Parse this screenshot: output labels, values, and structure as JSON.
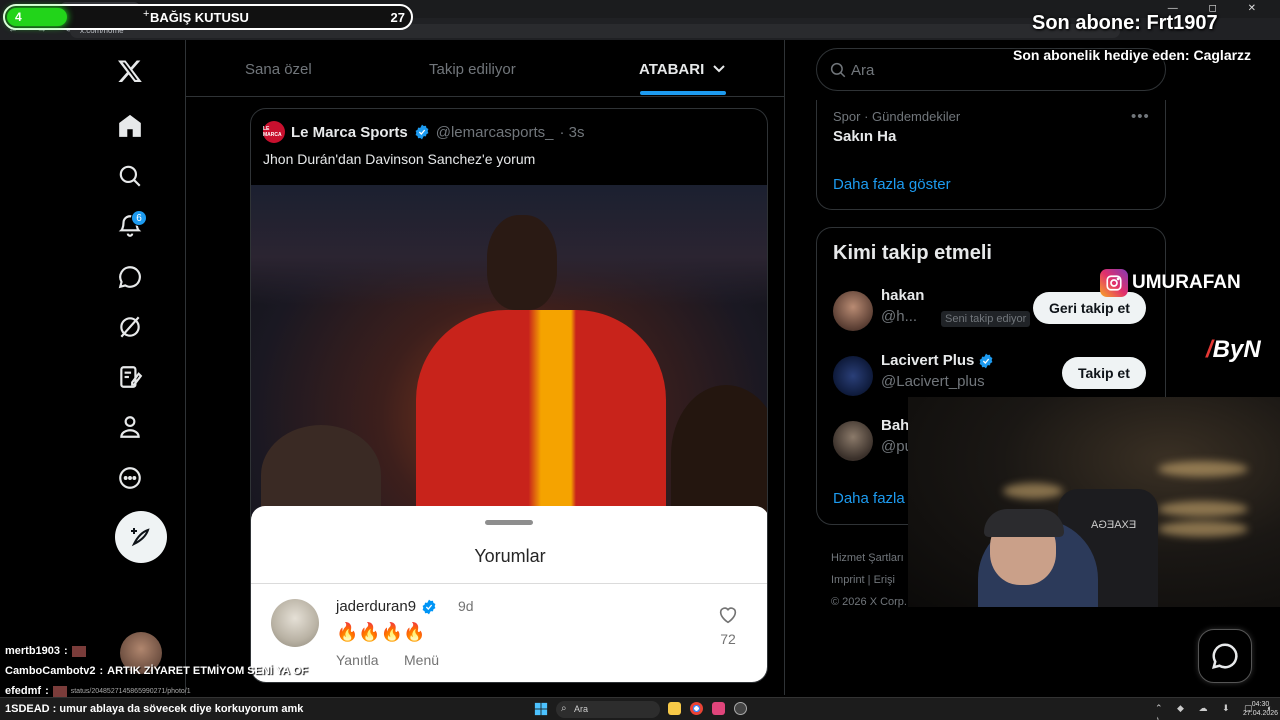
{
  "browser": {
    "tab_title": "/ X",
    "url": "x.com/home",
    "nav_glyphs": "← → ⟳",
    "window_controls": "—  ◻  ✕"
  },
  "donation": {
    "count": "4",
    "plus": "+",
    "label": "BAĞIŞ KUTUSU",
    "total": "27",
    "progress_fraction": 0.15,
    "color": "#22d41a"
  },
  "nav": {
    "icons": [
      "x-logo-icon",
      "home-icon",
      "search-icon",
      "notifications-icon",
      "messages-icon",
      "grok-icon",
      "lists-icon",
      "profile-icon",
      "more-icon",
      "post-icon"
    ],
    "notification_count": "6"
  },
  "feed_tabs": [
    {
      "label": "Sana özel"
    },
    {
      "label": "Takip ediliyor"
    },
    {
      "label": "ATABARI"
    }
  ],
  "tweet": {
    "logo_text": "LE MARCA",
    "author": "Le Marca Sports",
    "handle": "@lemarcasports_",
    "time": "· 3s",
    "text": "Jhon Durán'dan Davinson Sanchez'e yorum",
    "photo_alt": "GALATASARAY player celebrating"
  },
  "comments_sheet": {
    "title": "Yorumlar",
    "comment": {
      "user": "jaderduran9",
      "time": "9d",
      "body": "🔥🔥🔥🔥",
      "reply_label": "Yanıtla",
      "menu_label": "Menü",
      "likes": "72"
    }
  },
  "search": {
    "placeholder": "Ara"
  },
  "trend": {
    "category": "Spor · Gündemdekiler",
    "topic": "Sakın Ha",
    "dots": "•••",
    "show_more": "Daha fazla göster"
  },
  "who_to_follow": {
    "title": "Kimi takip etmeli",
    "accounts": [
      {
        "name": "hakan",
        "handle": "@h...",
        "follows_you": "Seni takip ediyor",
        "button": "Geri takip et"
      },
      {
        "name": "Lacivert Plus",
        "handle": "@Lacivert_plus",
        "button": "Takip et"
      },
      {
        "name": "Bah",
        "handle": "@pu"
      }
    ],
    "show_more": "Daha fazla"
  },
  "footer": {
    "line1": "Hizmet Şartları",
    "line2": "Imprint  |  Erişi",
    "line3": "© 2026 X Corp."
  },
  "overlays": {
    "last_sub": "Son abone: Frt1907",
    "last_gift": "Son abonelik hediye eden: Caglarzz",
    "instagram": "UMURAFAN",
    "brand": "ByN",
    "brand_slash": "/",
    "chair_text": "EXAEGA"
  },
  "chat": [
    {
      "user": "mertb1903",
      "message": ""
    },
    {
      "user": "CamboCambotv2",
      "message": "ARTIK ZİYARET ETMİYOM SENİ YA OF"
    },
    {
      "user": "efedmf",
      "message": "",
      "url": "status/2048527145865990271/photo/1"
    },
    {
      "user": "1SDEAD",
      "message": "umur ablaya da sövecek diye korkuyorum amk"
    }
  ],
  "taskbar": {
    "search_placeholder": "Ara",
    "tray_glyphs": "⌃ ◆ ☁ ⬇ ▢ ◐ ♪",
    "time": "04:30",
    "date": "27.04.2026"
  },
  "colors": {
    "accent": "#1d9bf0",
    "background": "#000000",
    "border": "#2f3336",
    "muted": "#71767b"
  }
}
